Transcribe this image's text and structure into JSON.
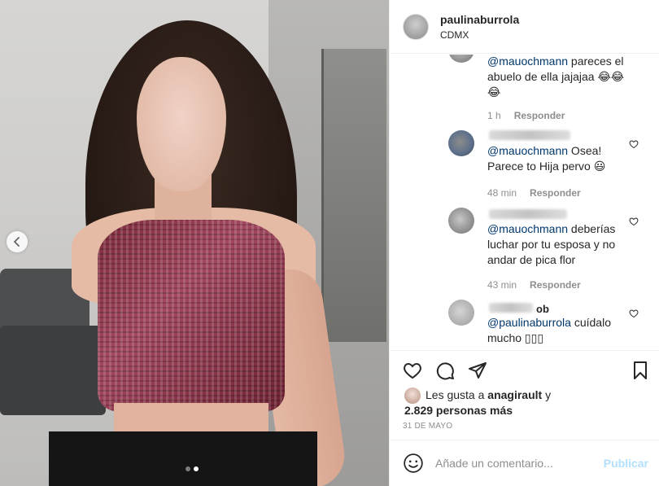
{
  "post": {
    "username": "paulinaburrola",
    "location": "CDMX",
    "date": "31 DE MAYO",
    "carousel": {
      "total": 2,
      "active": 2
    }
  },
  "comments": [
    {
      "text_mention": "@mauochmann",
      "text": " pareces el abuelo de ella jajajaa ",
      "emoji": "😂😂😂",
      "time": "1 h",
      "reply_label": "Responder"
    },
    {
      "text_mention": "@mauochmann",
      "text": " Osea! Parece to Hija pervo ",
      "emoji": "😃",
      "time": "48 min",
      "reply_label": "Responder"
    },
    {
      "text_mention": "@mauochmann",
      "text": " deberías luchar por tu esposa y no andar de pica flor",
      "time": "43 min",
      "reply_label": "Responder"
    },
    {
      "name_tail": "ob",
      "text_mention": "@paulinaburrola",
      "text": " cuídalo mucho ",
      "emoji": "▯▯▯"
    }
  ],
  "likes": {
    "prefix": "Les gusta a ",
    "user": "anagirault",
    "suffix": " y",
    "others": "2.829 personas más"
  },
  "add_comment": {
    "placeholder": "Añade un comentario...",
    "publish_label": "Publicar"
  },
  "icons": {
    "prev": "chevron-left-icon",
    "like": "heart-icon",
    "comment": "comment-icon",
    "share": "paper-plane-icon",
    "save": "bookmark-icon",
    "emoji": "smiley-icon"
  },
  "colors": {
    "mention": "#00376b",
    "publish": "#b2dffc",
    "meta": "#8e8e8e"
  }
}
